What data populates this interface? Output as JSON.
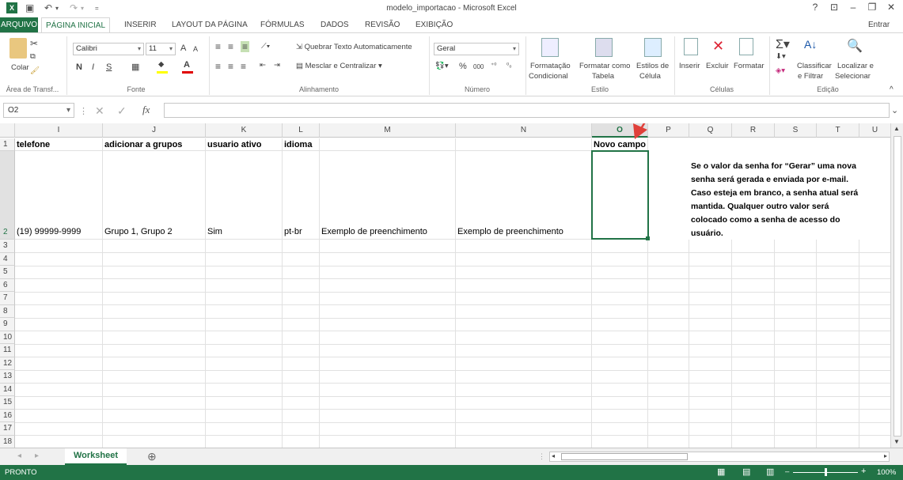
{
  "window": {
    "title": "modelo_importacao - Microsoft Excel",
    "help": "?",
    "ribbon_display": "⊡",
    "minimize": "–",
    "restore": "❐",
    "close": "✕"
  },
  "quick_access": {
    "save_icon": "💾",
    "undo": "↶",
    "redo": "↷"
  },
  "tabs": [
    {
      "label": "ARQUIVO"
    },
    {
      "label": "PÁGINA INICIAL"
    },
    {
      "label": "INSERIR"
    },
    {
      "label": "LAYOUT DA PÁGINA"
    },
    {
      "label": "FÓRMULAS"
    },
    {
      "label": "DADOS"
    },
    {
      "label": "REVISÃO"
    },
    {
      "label": "EXIBIÇÃO"
    }
  ],
  "account": "Entrar",
  "ribbon": {
    "clipboard": {
      "paste": "Colar",
      "label": "Área de Transf..."
    },
    "font": {
      "name": "Calibri",
      "size": "11",
      "bold": "N",
      "italic": "I",
      "underline": "S",
      "grow": "A",
      "shrink": "A",
      "label": "Fonte"
    },
    "alignment": {
      "wrap": "Quebrar Texto Automaticamente",
      "merge": "Mesclar e Centralizar",
      "label": "Alinhamento"
    },
    "number": {
      "format": "Geral",
      "percent": "%",
      "thousands": "000",
      "label": "Número"
    },
    "styles": {
      "conditional": "Formatação",
      "conditional2": "Condicional",
      "table": "Formatar como",
      "table2": "Tabela",
      "cell": "Estilos de",
      "cell2": "Célula",
      "label": "Estilo"
    },
    "cells": {
      "insert": "Inserir",
      "delete": "Excluir",
      "format": "Formatar",
      "label": "Células"
    },
    "editing": {
      "sort": "Classificar",
      "sort2": "e Filtrar",
      "find": "Localizar e",
      "find2": "Selecionar",
      "label": "Edição"
    }
  },
  "formula_bar": {
    "name_box": "O2",
    "fx": "fx",
    "cancel": "✕",
    "enter": "✓",
    "value": ""
  },
  "columns": [
    "I",
    "J",
    "K",
    "L",
    "M",
    "N",
    "O",
    "P",
    "Q",
    "R",
    "S",
    "T",
    "U"
  ],
  "rows": [
    "1",
    "2",
    "3",
    "4",
    "5",
    "6",
    "7",
    "8",
    "9",
    "10",
    "11",
    "12",
    "13",
    "14",
    "15",
    "16",
    "17",
    "18"
  ],
  "row1": {
    "I": "telefone",
    "J": "adicionar a grupos",
    "K": "usuario ativo",
    "L": "idioma",
    "O": "Novo campo"
  },
  "row2": {
    "I": "(19) 99999-9999",
    "J": "Grupo 1, Grupo 2",
    "K": "Sim",
    "L": "pt-br",
    "M": "Exemplo de preenchimento",
    "N": "Exemplo de preenchimento"
  },
  "note": "Se o valor da senha for “Gerar” uma nova senha será gerada e enviada por e-mail. Caso esteja em branco, a senha atual será mantida. Qualquer outro valor será colocado como a senha de acesso do usuário.",
  "sheet": {
    "name": "Worksheet",
    "add": "⊕"
  },
  "status": {
    "mode": "PRONTO",
    "zoom": "100%"
  }
}
